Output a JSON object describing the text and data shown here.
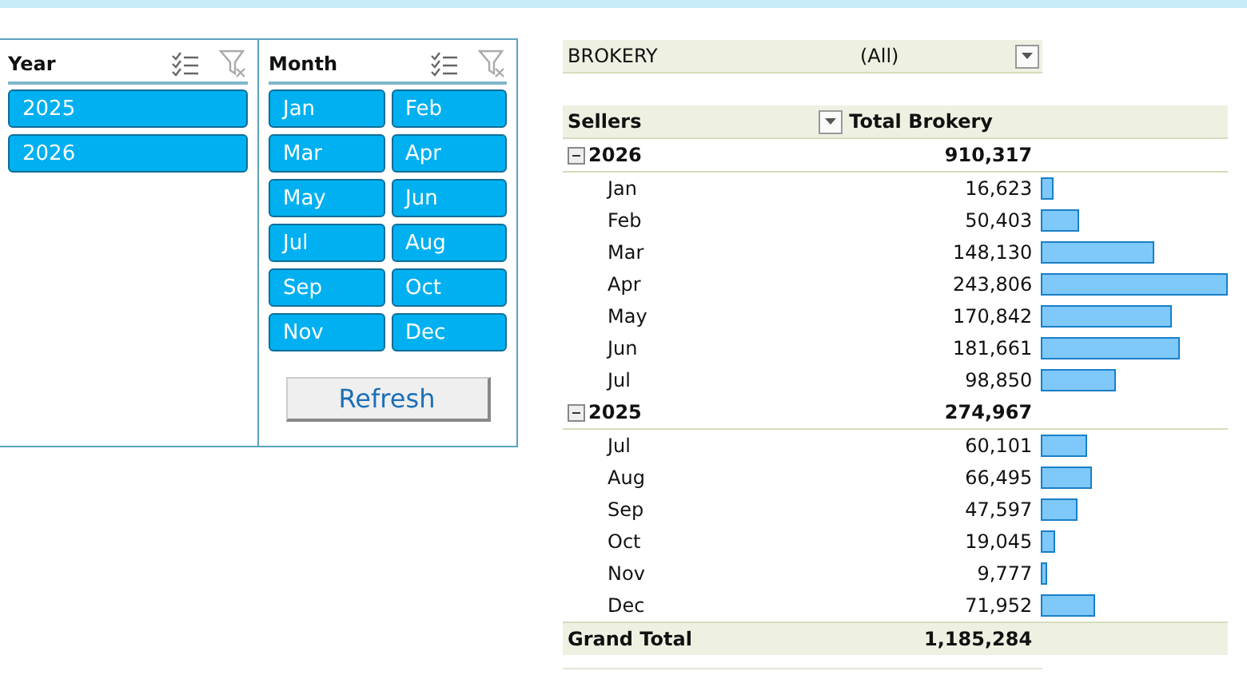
{
  "slicers": [
    {
      "title": "Year",
      "items": [
        {
          "label": "2025",
          "selected": true
        },
        {
          "label": "2026",
          "selected": true
        }
      ]
    },
    {
      "title": "Month",
      "items": [
        {
          "label": "Jan",
          "selected": true
        },
        {
          "label": "Feb",
          "selected": true
        },
        {
          "label": "Mar",
          "selected": true
        },
        {
          "label": "Apr",
          "selected": true
        },
        {
          "label": "May",
          "selected": true
        },
        {
          "label": "Jun",
          "selected": true
        },
        {
          "label": "Jul",
          "selected": true
        },
        {
          "label": "Aug",
          "selected": true
        },
        {
          "label": "Sep",
          "selected": true
        },
        {
          "label": "Oct",
          "selected": true
        },
        {
          "label": "Nov",
          "selected": true
        },
        {
          "label": "Dec",
          "selected": true
        }
      ],
      "button": "Refresh"
    }
  ],
  "pivot": {
    "filter": {
      "field": "BROKERY",
      "value": "(All)"
    },
    "columns": [
      "Sellers",
      "Total Brokery"
    ],
    "groups": [
      {
        "label": "2026",
        "total": "910,317",
        "expanded": true,
        "rows": [
          {
            "label": "Jan",
            "value": "16,623"
          },
          {
            "label": "Feb",
            "value": "50,403"
          },
          {
            "label": "Mar",
            "value": "148,130"
          },
          {
            "label": "Apr",
            "value": "243,806"
          },
          {
            "label": "May",
            "value": "170,842"
          },
          {
            "label": "Jun",
            "value": "181,661"
          },
          {
            "label": "Jul",
            "value": "98,850"
          }
        ]
      },
      {
        "label": "2025",
        "total": "274,967",
        "expanded": true,
        "rows": [
          {
            "label": "Jul",
            "value": "60,101"
          },
          {
            "label": "Aug",
            "value": "66,495"
          },
          {
            "label": "Sep",
            "value": "47,597"
          },
          {
            "label": "Oct",
            "value": "19,045"
          },
          {
            "label": "Nov",
            "value": "9,777"
          },
          {
            "label": "Dec",
            "value": "71,952"
          }
        ]
      }
    ],
    "grand_total": {
      "label": "Grand Total",
      "value": "1,185,284"
    }
  }
}
